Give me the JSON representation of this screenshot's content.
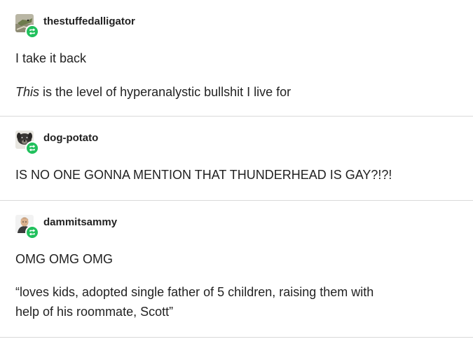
{
  "posts": [
    {
      "username": "thestuffedalligator",
      "avatar_icon": "alligator-avatar",
      "badge_icon": "reblog-icon",
      "lines": [
        {
          "text": "I take it back"
        },
        {
          "emphasis": "This",
          "text": " is the level of hyperanalystic bullshit I live for"
        }
      ]
    },
    {
      "username": "dog-potato",
      "avatar_icon": "dog-avatar",
      "badge_icon": "reblog-icon",
      "lines": [
        {
          "text": "IS NO ONE GONNA MENTION THAT THUNDERHEAD IS GAY?!?!"
        }
      ]
    },
    {
      "username": "dammitsammy",
      "avatar_icon": "person-avatar",
      "badge_icon": "reblog-icon",
      "lines": [
        {
          "text": "OMG OMG OMG"
        },
        {
          "text": "“loves kids, adopted single father of 5 children, raising them with"
        },
        {
          "text": "help of his roommate, Scott”"
        }
      ]
    }
  ],
  "colors": {
    "badge": "#20c05c",
    "separator": "#d9d9d9",
    "text": "#222222"
  }
}
